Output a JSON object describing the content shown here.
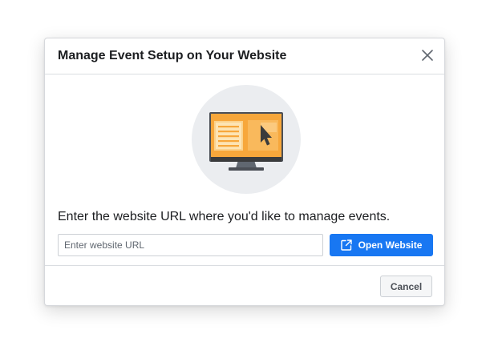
{
  "dialog": {
    "title": "Manage Event Setup on Your Website",
    "close_icon": "close-icon",
    "illustration_icon": "desktop-monitor-cursor-icon",
    "prompt": "Enter the website URL where you'd like to manage events.",
    "url_input": {
      "value": "",
      "placeholder": "Enter website URL"
    },
    "open_button": {
      "label": "Open Website",
      "icon": "external-link-icon"
    },
    "cancel_button": {
      "label": "Cancel"
    }
  },
  "colors": {
    "primary_button": "#1877f2",
    "illustration_circle": "#ebedf0",
    "illustration_screen": "#f7a73b",
    "text": "#1c1e21"
  }
}
